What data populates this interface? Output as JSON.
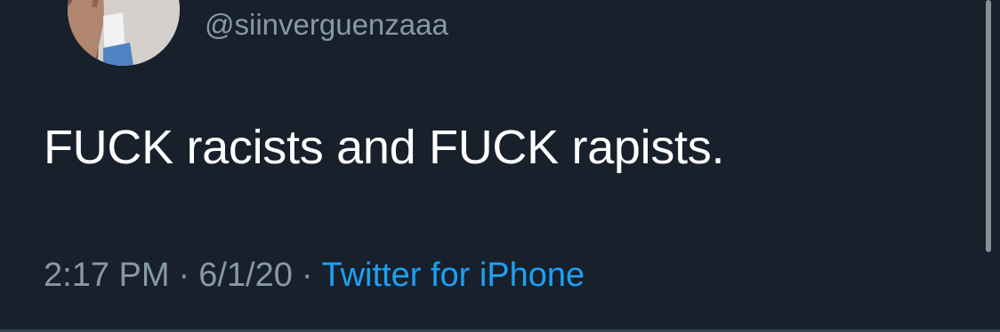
{
  "tweet": {
    "handle": "@siinverguenzaaa",
    "text": "FUCK racists and FUCK rapists.",
    "time": "2:17 PM",
    "separator": "·",
    "date": "6/1/20",
    "source": "Twitter for iPhone"
  },
  "colors": {
    "background": "#17202b",
    "text": "#ffffff",
    "muted": "#8899a6",
    "link": "#1da1f2"
  }
}
